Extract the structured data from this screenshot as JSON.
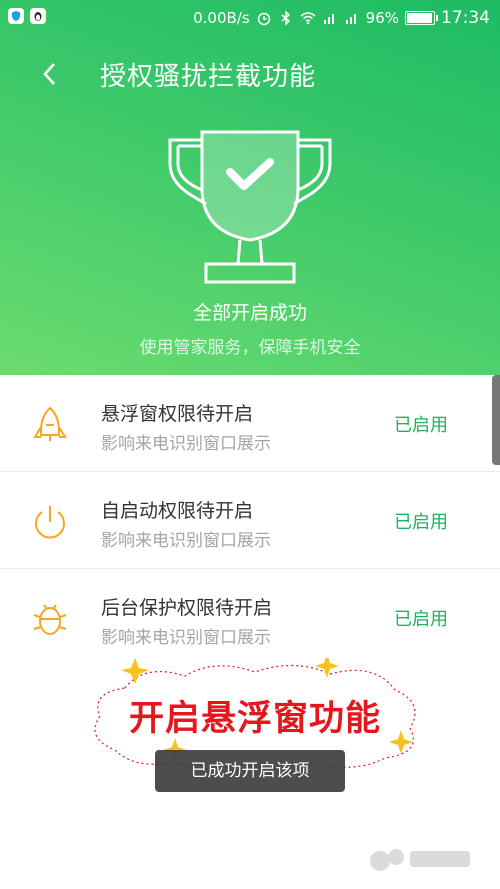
{
  "status_bar": {
    "speed": "0.00B/s",
    "battery": "96%",
    "time": "17:34",
    "icons": [
      "shield-app-icon",
      "penguin-app-icon",
      "alarm-icon",
      "bluetooth-icon",
      "wifi-icon",
      "signal-icon",
      "signal-icon",
      "battery-icon"
    ]
  },
  "header": {
    "title": "授权骚扰拦截功能",
    "back_icon": "back-arrow-icon"
  },
  "hero": {
    "icon": "trophy-check-icon",
    "title": "全部开启成功",
    "subtitle": "使用管家服务，保障手机安全"
  },
  "permissions": [
    {
      "icon": "rocket-icon",
      "title": "悬浮窗权限待开启",
      "desc": "影响来电识别窗口展示",
      "status": "已启用"
    },
    {
      "icon": "power-icon",
      "title": "自启动权限待开启",
      "desc": "影响来电识别窗口展示",
      "status": "已启用"
    },
    {
      "icon": "bug-icon",
      "title": "后台保护权限待开启",
      "desc": "影响来电识别窗口展示",
      "status": "已启用"
    }
  ],
  "annotation": {
    "text": "开启悬浮窗功能"
  },
  "toast": {
    "text": "已成功开启该项"
  },
  "colors": {
    "accent": "#1fb35b",
    "hero_start": "#1dbb63",
    "hero_end": "#6bdc6f",
    "icon_orange": "#f5a623",
    "annotation_red": "#e5161d"
  }
}
